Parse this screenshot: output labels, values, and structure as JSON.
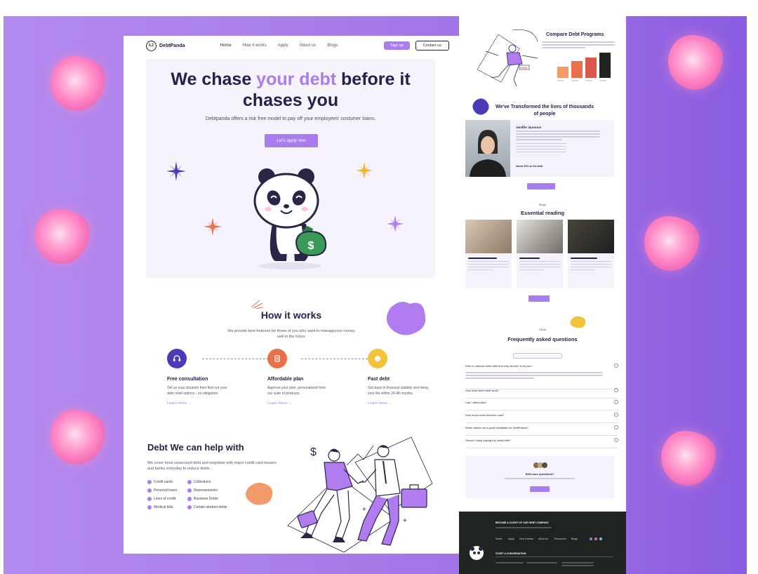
{
  "brand": {
    "name": "DebtPanda",
    "logo_mark": "5.2"
  },
  "nav": {
    "links": [
      "Home",
      "How it works",
      "Apply",
      "About us",
      "Blogs"
    ],
    "signup_label": "Sign up",
    "contact_label": "Contact us"
  },
  "hero": {
    "title_part1": "We chase ",
    "title_accent": "your debt",
    "title_part2": " before it chases you",
    "subtitle": "Debtpanda offers a risk free model to pay off your employees' costumer loans.",
    "cta_label": "Let's apply now"
  },
  "how": {
    "title": "How it works",
    "subtitle": "We provide best features for those of you who want to manageyour money well in the future",
    "steps": [
      {
        "title": "Free consultation",
        "desc": "Tell us your situation then find out your debt relief options - no obligation.",
        "more": "Learn more →",
        "color": "#4b3bb8",
        "icon": "headset-icon"
      },
      {
        "title": "Affordable plan",
        "desc": "Approve your plan, personalized from our suite of products.",
        "more": "Learn more →",
        "color": "#e8704a",
        "icon": "document-icon"
      },
      {
        "title": "Fast debt",
        "desc": "Get back to financial stability and living your life within 24-48 months.",
        "more": "Learn more →",
        "color": "#f3c33b",
        "icon": "coin-icon"
      }
    ]
  },
  "debt": {
    "title": "Debt We can help with",
    "subtitle": "We cover most unsecured debt and negotiate with major credit card issuers and banks everyday to reduce debts.",
    "items": [
      "Credit cards",
      "Collections",
      "Personal loans",
      "Repossessions",
      "Lines of credit",
      "Business Debts",
      "Medical bills",
      "Certain student debts"
    ]
  },
  "right": {
    "compare_title": "Compare Debt Programs",
    "chart_badge": "FREE",
    "transformed_title": "We've Transformed the lives of thousands of people",
    "testimonial_name": "Jeniffer laurence",
    "testimonial_saved": "Saved 25% on the debt",
    "blogs_tag": "Blogs",
    "blogs_title": "Essential reading",
    "faq_tag": "FAQs",
    "faq_title": "Frequently asked questions",
    "faq_questions": [
      "Who is national debt relief and why should i trust you?",
      "How does debt relief work?",
      "Can i afford this?",
      "How much does services cost?",
      "What makes me a good candidate for DebtPanda?",
      "Should i keep paying my credit bills?"
    ],
    "more_questions": "Still more questions?",
    "footer_heading": "BECOME A CLIENT OF OUR DEBT COMPANY",
    "footer_conversation": "START A CONVERSATION",
    "footer_links": [
      "Home",
      "Apply",
      "How it works",
      "About us",
      "Resources",
      "Blogs"
    ]
  },
  "colors": {
    "accent": "#a97cf0",
    "dark": "#25214a",
    "footer": "#1f2420"
  }
}
